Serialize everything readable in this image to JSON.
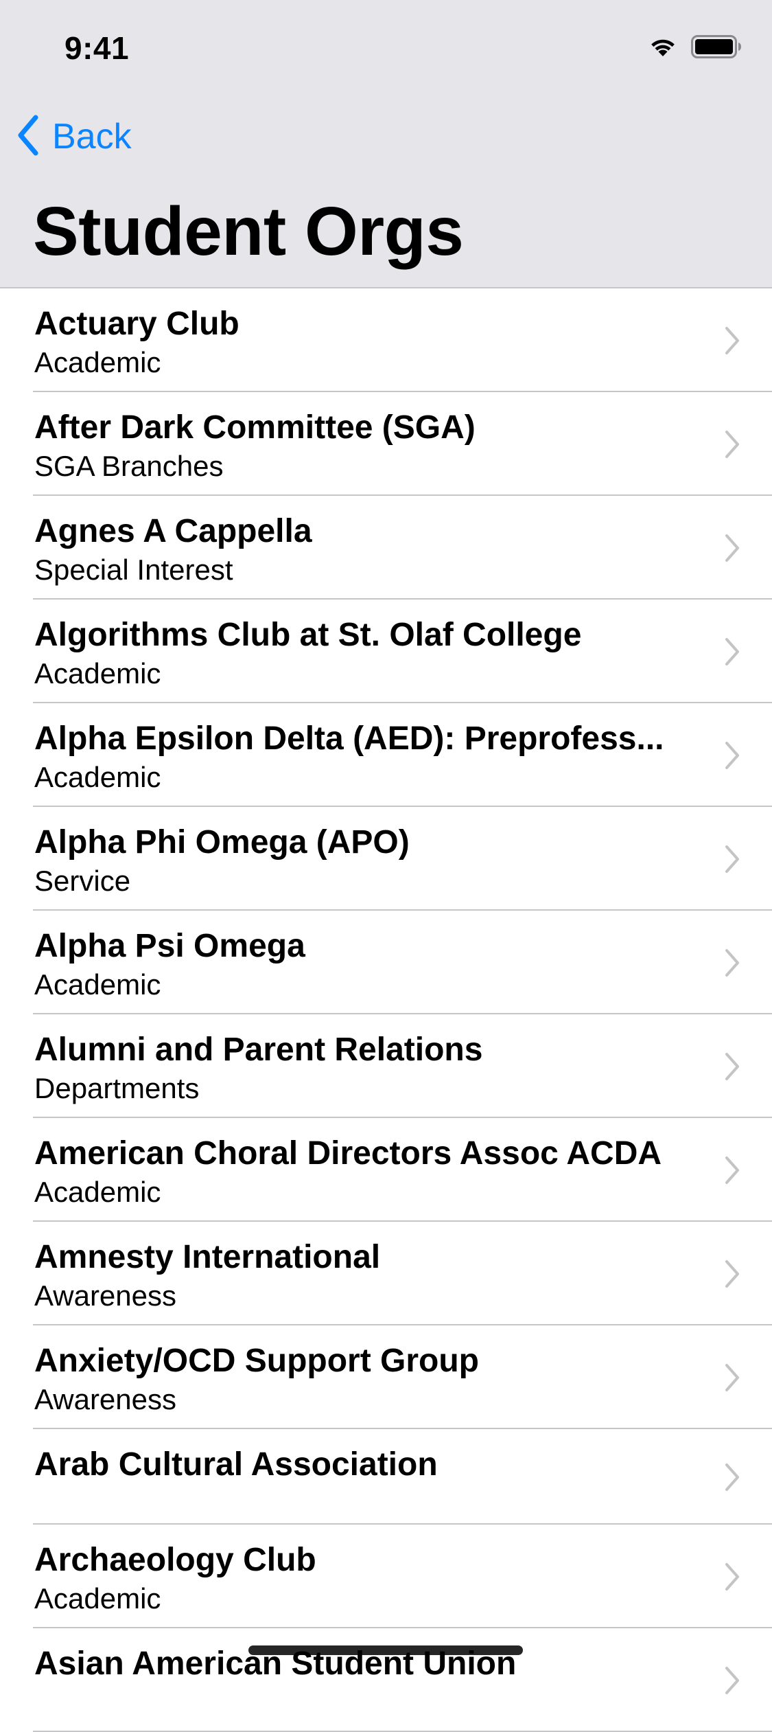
{
  "status_bar": {
    "time": "9:41",
    "icons": [
      "wifi-icon",
      "battery-icon"
    ]
  },
  "nav": {
    "back_label": "Back",
    "title": "Student Orgs",
    "accent_color": "#0a84ff"
  },
  "orgs": [
    {
      "name": "Actuary Club",
      "category": "Academic"
    },
    {
      "name": "After Dark Committee (SGA)",
      "category": "SGA Branches"
    },
    {
      "name": "Agnes A Cappella",
      "category": "Special Interest"
    },
    {
      "name": "Algorithms Club at St. Olaf College",
      "category": "Academic"
    },
    {
      "name": "Alpha Epsilon Delta (AED): Preprofess...",
      "category": "Academic"
    },
    {
      "name": "Alpha Phi Omega (APO)",
      "category": "Service"
    },
    {
      "name": "Alpha Psi Omega",
      "category": "Academic"
    },
    {
      "name": "Alumni and Parent Relations",
      "category": "Departments"
    },
    {
      "name": "American Choral Directors Assoc ACDA",
      "category": "Academic"
    },
    {
      "name": "Amnesty International",
      "category": "Awareness"
    },
    {
      "name": "Anxiety/OCD Support Group",
      "category": "Awareness"
    },
    {
      "name": "Arab Cultural Association",
      "category": ""
    },
    {
      "name": "Archaeology Club",
      "category": "Academic"
    },
    {
      "name": "Asian American Student Union",
      "category": ""
    }
  ]
}
